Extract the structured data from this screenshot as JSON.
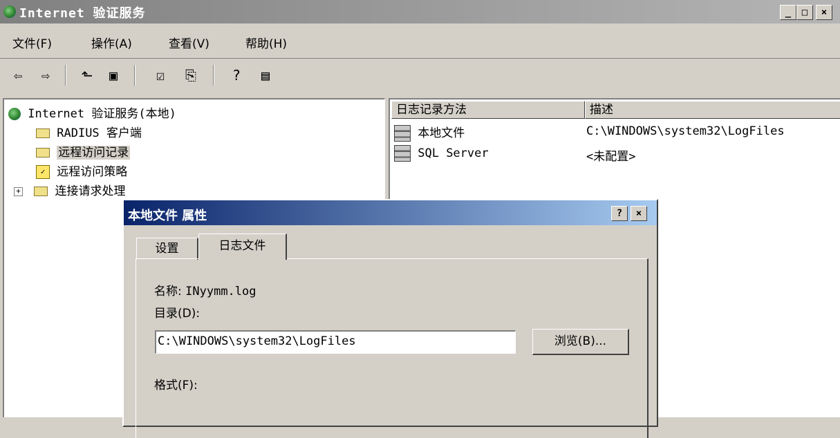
{
  "window": {
    "title": "Internet 验证服务"
  },
  "caption_buttons": {
    "minimize": "_",
    "maximize": "□",
    "close": "×"
  },
  "menu": [
    "文件(F)",
    "操作(A)",
    "查看(V)",
    "帮助(H)"
  ],
  "toolbar": {
    "back": "⇦",
    "forward": "⇨",
    "up": "⬑",
    "show_hide_tree": "▣",
    "properties": "☑",
    "export": "⎘",
    "help": "?",
    "show_hide_action": "▤"
  },
  "tree": {
    "root": "Internet 验证服务(本地)",
    "items": [
      "RADIUS 客户端",
      "远程访问记录",
      "远程访问策略",
      "连接请求处理"
    ]
  },
  "list": {
    "columns": [
      "日志记录方法",
      "描述"
    ],
    "rows": [
      {
        "name": "本地文件",
        "desc": "C:\\WINDOWS\\system32\\LogFiles"
      },
      {
        "name": "SQL Server",
        "desc": "<未配置>"
      }
    ]
  },
  "dialog": {
    "title": "本地文件 属性",
    "help_btn": "?",
    "close_btn": "×",
    "tabs": [
      "设置",
      "日志文件"
    ],
    "name_label": "名称:",
    "name_value": "INyymm.log",
    "dir_label": "目录(D):",
    "dir_value": "C:\\WINDOWS\\system32\\LogFiles",
    "browse_label": "浏览(B)...",
    "format_label": "格式(F):"
  }
}
